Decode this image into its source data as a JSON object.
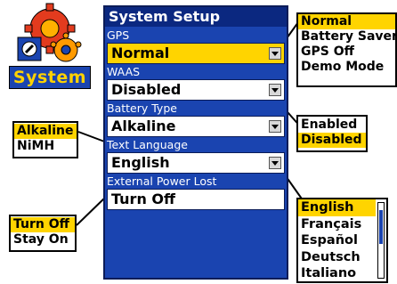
{
  "app_icon": {
    "label": "System"
  },
  "window": {
    "title": "System Setup",
    "fields": {
      "gps": {
        "label": "GPS",
        "value": "Normal"
      },
      "waas": {
        "label": "WAAS",
        "value": "Disabled"
      },
      "battery": {
        "label": "Battery Type",
        "value": "Alkaline"
      },
      "language": {
        "label": "Text Language",
        "value": "English"
      },
      "power": {
        "label": "External Power Lost",
        "value": "Turn Off"
      }
    }
  },
  "options": {
    "gps": [
      "Normal",
      "Battery Saver",
      "GPS Off",
      "Demo Mode"
    ],
    "waas": [
      "Enabled",
      "Disabled"
    ],
    "battery": [
      "Alkaline",
      "NiMH"
    ],
    "language": [
      "English",
      "Français",
      "Español",
      "Deutsch",
      "Italiano"
    ],
    "power": [
      "Turn Off",
      "Stay On"
    ]
  },
  "colors": {
    "window_bg": "#1a44b0",
    "title_bg": "#0b2880",
    "highlight": "#ffd400",
    "icon_label_text": "#ffd200"
  }
}
